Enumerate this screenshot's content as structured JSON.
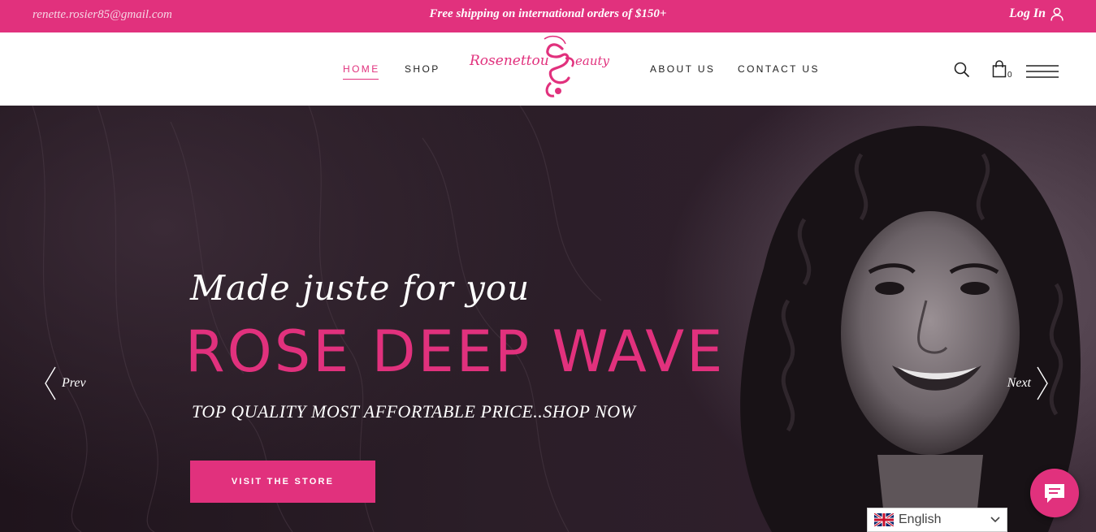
{
  "topbar": {
    "email": "renette.rosier85@gmail.com",
    "promo": "Free shipping on international orders of $150+",
    "login": "Log In",
    "login_icon": "user-icon"
  },
  "nav": {
    "items": [
      {
        "label": "HOME",
        "active": true
      },
      {
        "label": "SHOP",
        "active": false
      },
      {
        "label": "ABOUT US",
        "active": false
      },
      {
        "label": "CONTACT US",
        "active": false
      }
    ],
    "logo_text": "Rosenettou Beauty",
    "cart_count": "0",
    "icons": [
      "search-icon",
      "cart-icon",
      "menu-icon"
    ]
  },
  "hero": {
    "tagline": "Made juste for you",
    "title": "ROSE DEEP WAVE",
    "subtitle": "TOP QUALITY MOST AFFORTABLE PRICE..SHOP NOW",
    "button": "VISIT THE STORE",
    "prev": "Prev",
    "next": "Next"
  },
  "language": {
    "selected": "English",
    "flag_icon": "uk-flag-icon"
  },
  "colors": {
    "accent": "#e1317d",
    "hero_bg": "#2b1e28"
  }
}
